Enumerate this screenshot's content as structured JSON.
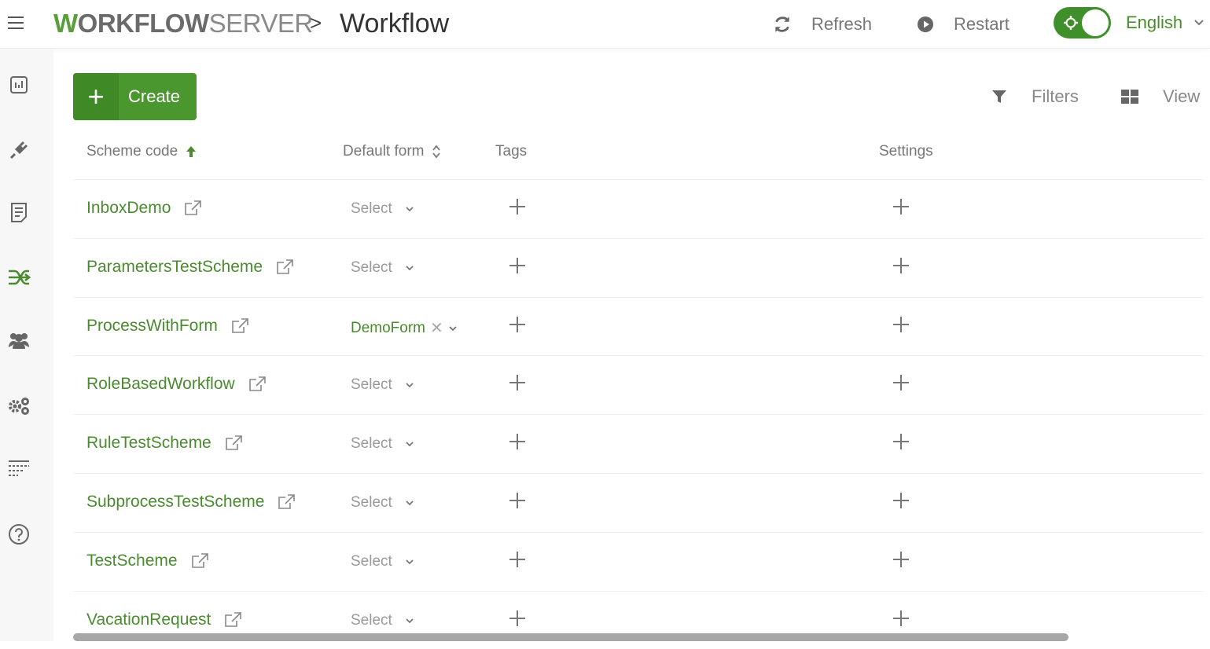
{
  "header": {
    "logo_text_bold": "WORKFLOW",
    "logo_text_light": "SERVER",
    "breadcrumb_separator": ">",
    "title": "Workflow",
    "refresh_label": "Refresh",
    "restart_label": "Restart",
    "language": "English",
    "toggle_on": true
  },
  "sidebar": {
    "items": [
      {
        "icon": "dashboard-icon"
      },
      {
        "icon": "plugin-icon"
      },
      {
        "icon": "document-icon"
      },
      {
        "icon": "workflow-icon",
        "active": true
      },
      {
        "icon": "users-icon"
      },
      {
        "icon": "settings-gears-icon"
      },
      {
        "icon": "list-icon"
      },
      {
        "icon": "help-icon"
      }
    ]
  },
  "toolbar": {
    "create_label": "Create",
    "filters_label": "Filters",
    "view_label": "View"
  },
  "table": {
    "columns": {
      "scheme_code": "Scheme code",
      "default_form": "Default form",
      "tags": "Tags",
      "settings": "Settings"
    },
    "rows": [
      {
        "code": "InboxDemo",
        "form": "Select",
        "form_selected": false
      },
      {
        "code": "ParametersTestScheme",
        "form": "Select",
        "form_selected": false
      },
      {
        "code": "ProcessWithForm",
        "form": "DemoForm",
        "form_selected": true
      },
      {
        "code": "RoleBasedWorkflow",
        "form": "Select",
        "form_selected": false
      },
      {
        "code": "RuleTestScheme",
        "form": "Select",
        "form_selected": false
      },
      {
        "code": "SubprocessTestScheme",
        "form": "Select",
        "form_selected": false
      },
      {
        "code": "TestScheme",
        "form": "Select",
        "form_selected": false
      },
      {
        "code": "VacationRequest",
        "form": "Select",
        "form_selected": false
      }
    ]
  },
  "colors": {
    "accent": "#4a962f",
    "link": "#4a8b30",
    "sidebar_bg": "#f7f7f7"
  }
}
